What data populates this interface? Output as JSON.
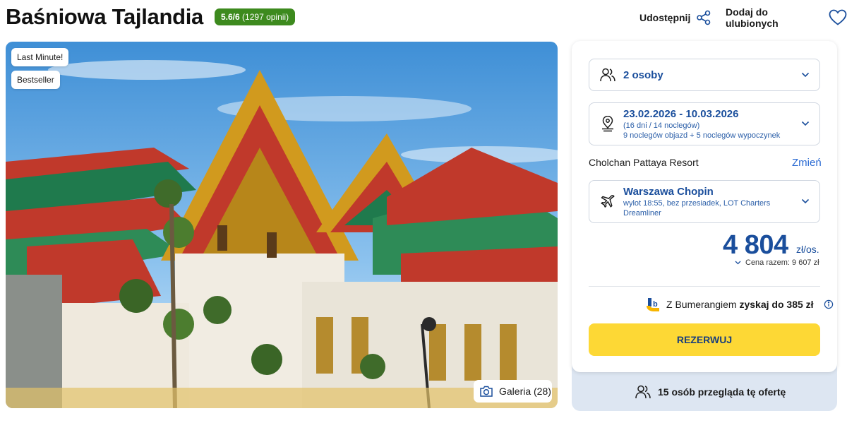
{
  "header": {
    "title": "Baśniowa Tajlandia",
    "rating_score": "5.6/6",
    "rating_reviews": "(1297 opinii)",
    "share_label": "Udostępnij",
    "favorite_label": "Dodaj do ulubionych"
  },
  "hero": {
    "badges": [
      "Last Minute!",
      "Bestseller"
    ],
    "gallery_label": "Galeria (28)"
  },
  "booking": {
    "persons": "2 osoby",
    "dates": "23.02.2026 - 10.03.2026",
    "duration": "(16 dni / 14 noclegów)",
    "nights_detail": "9 noclegów objazd + 5 noclegów wypoczynek",
    "hotel": "Cholchan Pattaya Resort",
    "change_label": "Zmień",
    "departure_airport": "Warszawa Chopin",
    "flight_detail_line1": "wylot 18:55, bez przesiadek, LOT Charters",
    "flight_detail_line2": "Dreamliner",
    "price": "4 804",
    "price_unit": "zł/os.",
    "total_price": "Cena razem: 9 607 zł",
    "bumerang_prefix": "Z Bumerangiem",
    "bumerang_bold": "zyskaj do 385 zł",
    "reserve_label": "REZERWUJ",
    "viewers": "15 osób przegląda tę ofertę"
  },
  "colors": {
    "accent_blue": "#1a4e9c",
    "link_blue": "#2a6ad3",
    "rating_green": "#3d8a1e",
    "reserve_yellow": "#fdd835"
  }
}
